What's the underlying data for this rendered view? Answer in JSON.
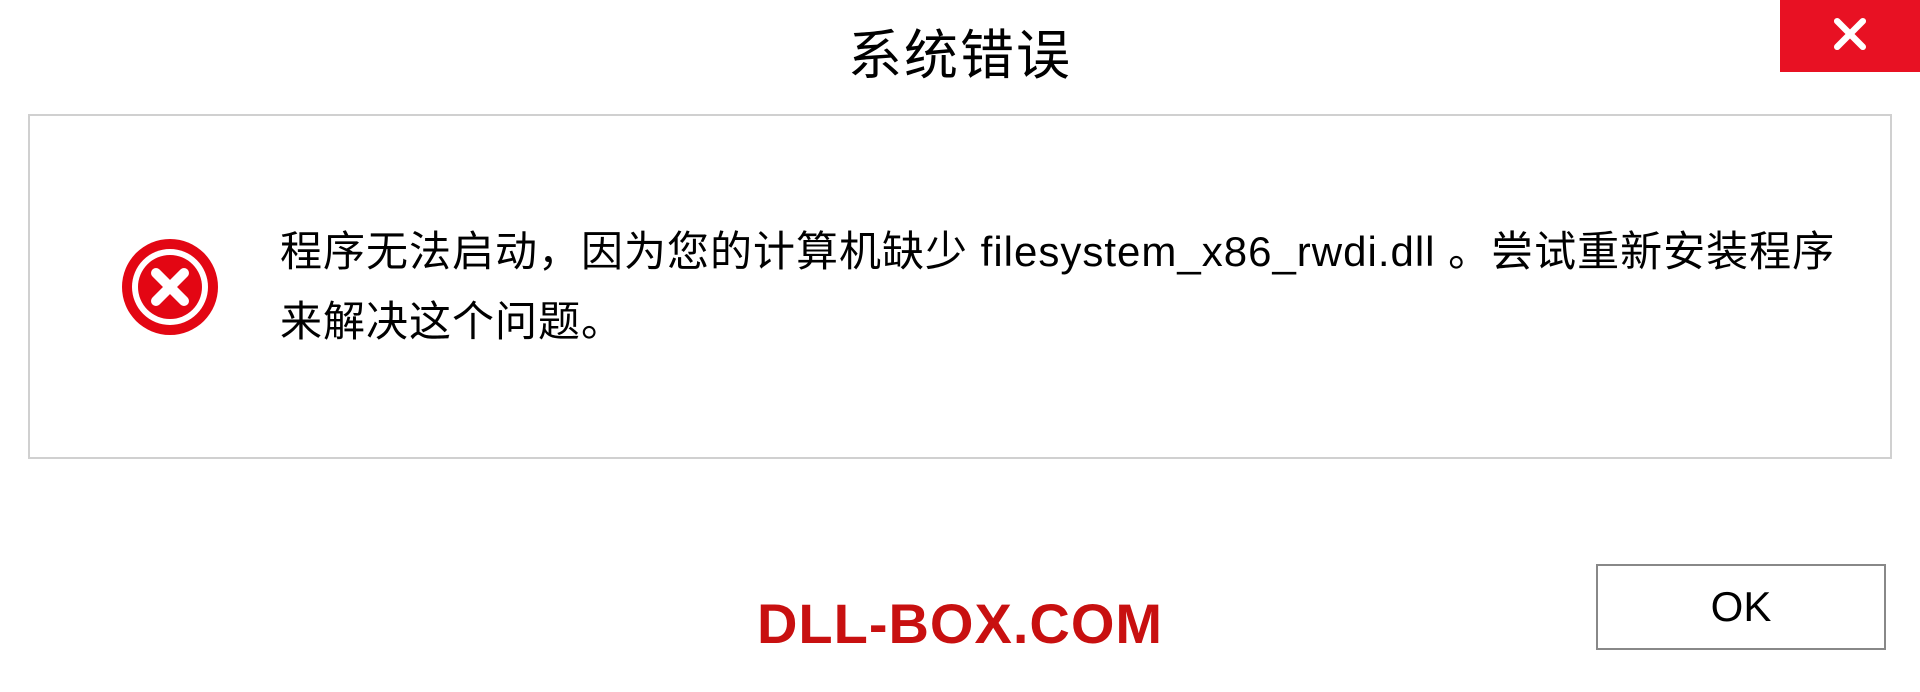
{
  "dialog": {
    "title": "系统错误",
    "message": "程序无法启动，因为您的计算机缺少 filesystem_x86_rwdi.dll 。尝试重新安装程序来解决这个问题。",
    "ok_label": "OK"
  },
  "watermark": "DLL-BOX.COM",
  "colors": {
    "close_bg": "#e81123",
    "error_icon": "#e30613",
    "watermark": "#c81010"
  }
}
